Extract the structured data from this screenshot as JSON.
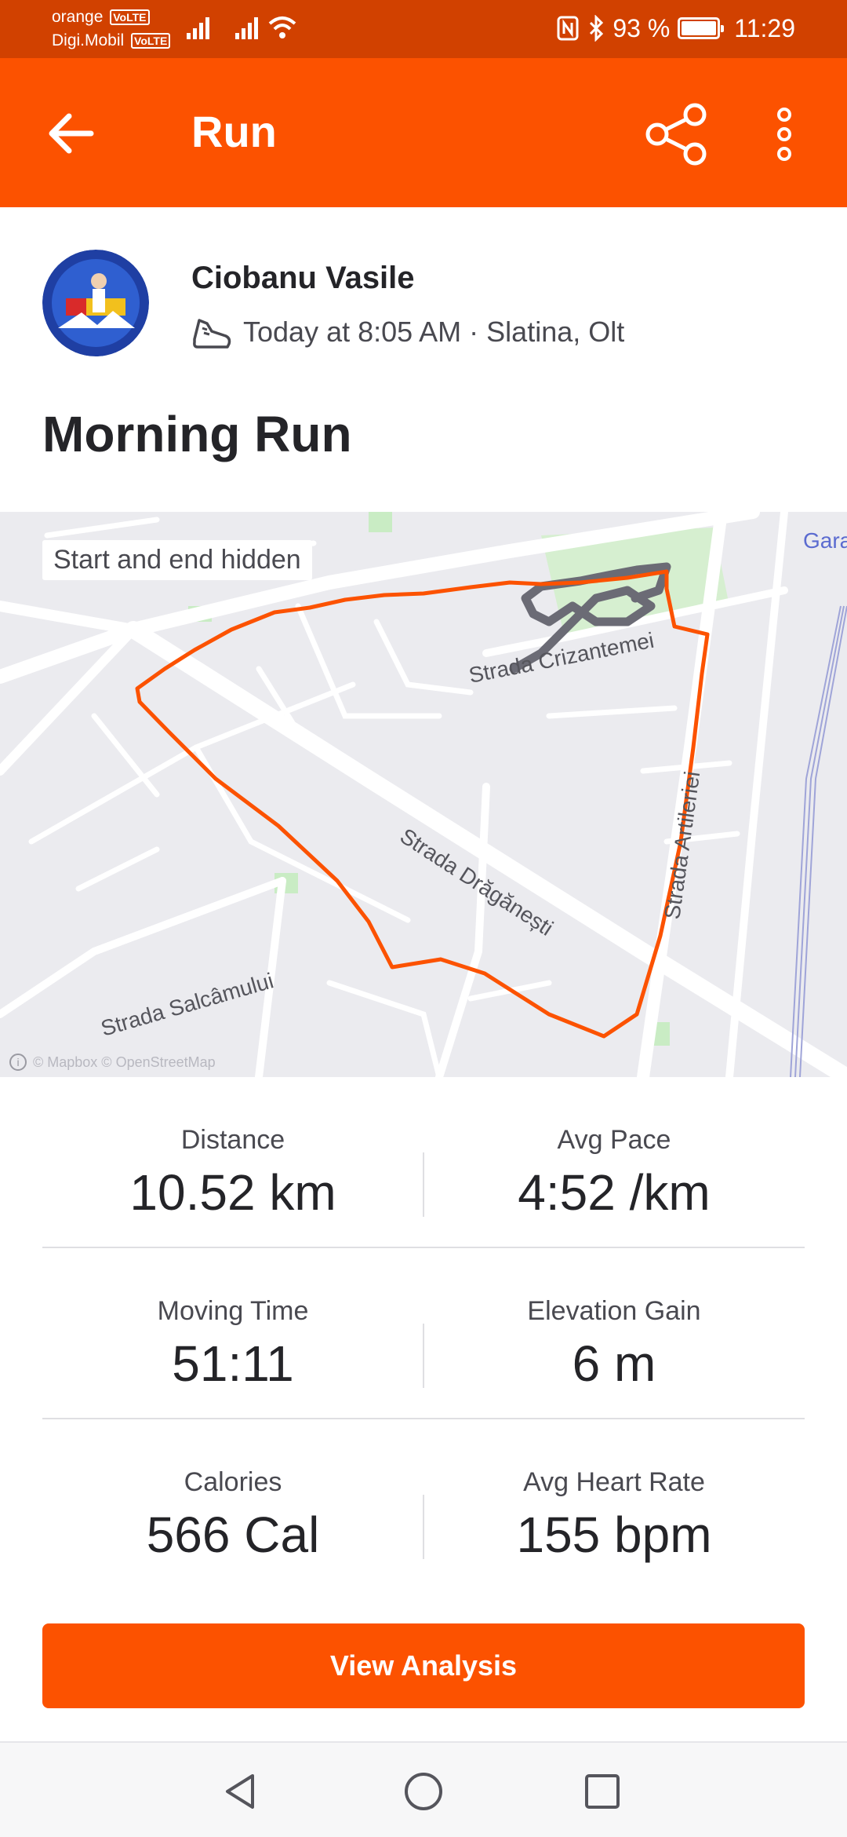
{
  "status_bar": {
    "carrier1": "orange",
    "carrier2": "Digi.Mobil",
    "volte": "VoLTE",
    "battery_text": "93 %",
    "battery_level": 0.93,
    "time": "11:29"
  },
  "app_bar": {
    "title": "Run",
    "back_icon": "arrow-left-icon",
    "share_icon": "share-icon",
    "more_icon": "more-vertical-icon"
  },
  "athlete": {
    "name": "Ciobanu Vasile",
    "meta": "Today at 8:05 AM · Slatina, Olt",
    "shoe_icon": "running-shoe-icon"
  },
  "activity": {
    "title": "Morning Run"
  },
  "map": {
    "badge": "Start and end hidden",
    "streets": {
      "crizantemei": "Strada Crizantemei",
      "draganesti": "Strada Drăgănești",
      "salcamului": "Strada Salcâmului",
      "artileriei": "Strada Artileriei",
      "gara": "Gara"
    },
    "attribution": "© Mapbox © OpenStreetMap",
    "route_color": "#fc5200",
    "hidden_route_color": "#6b6b75"
  },
  "stats": [
    {
      "label": "Distance",
      "value": "10.52 km"
    },
    {
      "label": "Avg Pace",
      "value": "4:52 /km"
    },
    {
      "label": "Moving Time",
      "value": "51:11"
    },
    {
      "label": "Elevation Gain",
      "value": "6 m"
    },
    {
      "label": "Calories",
      "value": "566 Cal"
    },
    {
      "label": "Avg Heart Rate",
      "value": "155 bpm"
    }
  ],
  "actions": {
    "view_analysis": "View Analysis"
  },
  "nav": {
    "back_icon": "nav-back-icon",
    "home_icon": "nav-home-icon",
    "recents_icon": "nav-recents-icon"
  },
  "colors": {
    "brand": "#fc5200",
    "status_bar": "#d14100"
  }
}
